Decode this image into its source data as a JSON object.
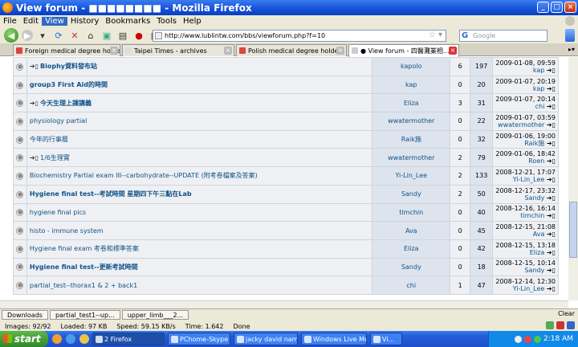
{
  "window": {
    "title": "View forum - ■■■■■■■■ - Mozilla Firefox"
  },
  "menu": [
    "File",
    "Edit",
    "View",
    "History",
    "Bookmarks",
    "Tools",
    "Help"
  ],
  "address": {
    "url": "http://www.lublintw.com/bbs/viewforum.php?f=10"
  },
  "search": {
    "placeholder": "Google",
    "engine": "G"
  },
  "tabs": [
    {
      "label": "Foreign medical degree holders ...",
      "active": false
    },
    {
      "label": "Taipei Times - archives",
      "active": false
    },
    {
      "label": "Polish medical degree holders a...",
      "active": false
    },
    {
      "label": "● View forum - 四醫灘業相...",
      "active": true
    }
  ],
  "topics": [
    {
      "hot": true,
      "title": "Biophy資料發布站",
      "bold": true,
      "author": "kapolo",
      "replies": "6",
      "views": "197",
      "last_date": "2009-01-08, 09:59",
      "last_user": "kap"
    },
    {
      "hot": false,
      "title": "group3 First Aid的時間",
      "bold": true,
      "author": "kap",
      "replies": "0",
      "views": "20",
      "last_date": "2009-01-07, 20:19",
      "last_user": "kap"
    },
    {
      "hot": true,
      "title": "今天生理上課講義",
      "bold": true,
      "author": "Eliza",
      "replies": "3",
      "views": "31",
      "last_date": "2009-01-07, 20:14",
      "last_user": "chi"
    },
    {
      "hot": false,
      "title": "physiology partial",
      "bold": false,
      "author": "wwatermother",
      "replies": "0",
      "views": "22",
      "last_date": "2009-01-07, 03:59",
      "last_user": "wwatermother"
    },
    {
      "hot": false,
      "title": "今年的行事曆",
      "bold": false,
      "author": "Raik施",
      "replies": "0",
      "views": "32",
      "last_date": "2009-01-06, 19:00",
      "last_user": "Raik施"
    },
    {
      "hot": true,
      "title": "1/6生理實",
      "bold": false,
      "author": "wwatermother",
      "replies": "2",
      "views": "79",
      "last_date": "2009-01-06, 18:42",
      "last_user": "Roen"
    },
    {
      "hot": false,
      "title": "Biochemistry Partial exam III--carbohydrate--UPDATE (附考卷檔案及答案)",
      "bold": false,
      "author": "Yi-Lin_Lee",
      "replies": "2",
      "views": "133",
      "last_date": "2008-12-21, 17:07",
      "last_user": "Yi-Lin_Lee"
    },
    {
      "hot": false,
      "title": "Hygiene final test--考試時間 星期四下午三點在Lab",
      "bold": true,
      "author": "Sandy",
      "replies": "2",
      "views": "50",
      "last_date": "2008-12-17, 23:32",
      "last_user": "Sandy"
    },
    {
      "hot": false,
      "title": "hygiene final pics",
      "bold": false,
      "author": "timchin",
      "replies": "0",
      "views": "40",
      "last_date": "2008-12-16, 16:14",
      "last_user": "timchin"
    },
    {
      "hot": false,
      "title": "histo - immune system",
      "bold": false,
      "author": "Ava",
      "replies": "0",
      "views": "45",
      "last_date": "2008-12-15, 21:08",
      "last_user": "Ava"
    },
    {
      "hot": false,
      "title": "Hygiene final exam 考卷和標準答案",
      "bold": false,
      "author": "Eliza",
      "replies": "0",
      "views": "42",
      "last_date": "2008-12-15, 13:18",
      "last_user": "Eliza"
    },
    {
      "hot": false,
      "title": "Hygiene final test--更新考試時間",
      "bold": true,
      "author": "Sandy",
      "replies": "0",
      "views": "18",
      "last_date": "2008-12-15, 10:14",
      "last_user": "Sandy"
    },
    {
      "hot": false,
      "title": "partial_test--thorax1 & 2 + back1",
      "bold": false,
      "author": "chi",
      "replies": "1",
      "views": "47",
      "last_date": "2008-12-14, 12:30",
      "last_user": "Yi-Lin_Lee"
    }
  ],
  "downloads": {
    "label": "Downloads",
    "items": [
      "partial_test1--up...",
      "upper_limb___2..."
    ],
    "clear": "Clear"
  },
  "status": {
    "images": "Images: 92/92",
    "loaded": "Loaded: 97 KB",
    "speed": "Speed: 59.15 KB/s",
    "time": "Time: 1.642",
    "done": "Done"
  },
  "taskbar": {
    "start": "start",
    "tasks": [
      "2 Firefox",
      "PChome-Skype (...",
      "jacky david name...",
      "Windows Live Me...",
      "Vi..."
    ],
    "clock": "2:18 AM"
  }
}
